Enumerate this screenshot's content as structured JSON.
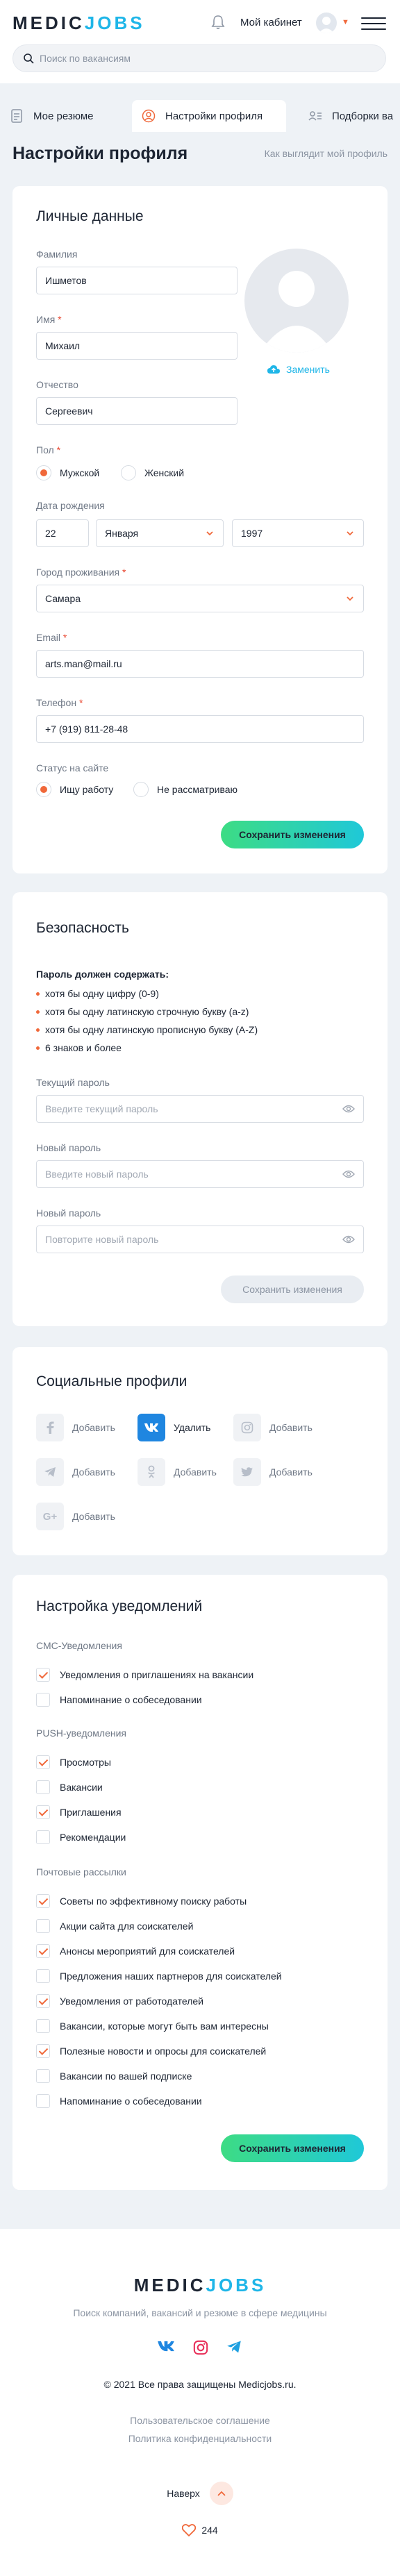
{
  "header": {
    "logo_part1": "MEDIC",
    "logo_part2": "JOBS",
    "cabinet_label": "Мой кабинет",
    "search_placeholder": "Поиск по вакансиям"
  },
  "tabs": [
    {
      "label": "Мое резюме"
    },
    {
      "label": "Настройки профиля"
    },
    {
      "label": "Подборки ва"
    }
  ],
  "page": {
    "title": "Настройки профиля",
    "view_link": "Как выглядит мой профиль"
  },
  "personal": {
    "heading": "Личные данные",
    "lastname_label": "Фамилия",
    "lastname_value": "Ишметов",
    "firstname_label": "Имя",
    "firstname_value": "Михаил",
    "middlename_label": "Отчество",
    "middlename_value": "Сергеевич",
    "replace_photo": "Заменить",
    "gender_label": "Пол",
    "gender_male": "Мужской",
    "gender_female": "Женский",
    "birth_label": "Дата рождения",
    "birth_day": "22",
    "birth_month": "Января",
    "birth_year": "1997",
    "city_label": "Город проживания",
    "city_value": "Самара",
    "email_label": "Email",
    "email_value": "arts.man@mail.ru",
    "phone_label": "Телефон",
    "phone_value": "+7 (919) 811-28-48",
    "status_label": "Статус на сайте",
    "status_looking": "Ищу работу",
    "status_not": "Не рассматриваю",
    "save": "Сохранить изменения",
    "required_mark": "*"
  },
  "security": {
    "heading": "Безопасность",
    "rules_title": "Пароль должен содержать:",
    "rules": [
      "хотя бы одну цифру (0-9)",
      "хотя бы одну латинскую строчную букву (a-z)",
      "хотя бы одну латинскую прописную букву (A-Z)",
      "6 знаков и более"
    ],
    "current_label": "Текущий пароль",
    "current_placeholder": "Введите текущий пароль",
    "new_label": "Новый пароль",
    "new_placeholder": "Введите новый пароль",
    "repeat_label": "Новый пароль",
    "repeat_placeholder": "Повторите новый пароль",
    "save": "Сохранить изменения"
  },
  "social": {
    "heading": "Социальные профили",
    "items": [
      {
        "icon": "facebook-icon",
        "action": "Добавить"
      },
      {
        "icon": "vk-icon",
        "action": "Удалить"
      },
      {
        "icon": "instagram-icon",
        "action": "Добавить"
      },
      {
        "icon": "telegram-icon",
        "action": "Добавить"
      },
      {
        "icon": "odnoklassniki-icon",
        "action": "Добавить"
      },
      {
        "icon": "twitter-icon",
        "action": "Добавить"
      },
      {
        "icon": "google-plus-icon",
        "action": "Добавить"
      }
    ]
  },
  "notifications": {
    "heading": "Настройка уведомлений",
    "sms_title": "СМС-Уведомления",
    "sms": [
      {
        "label": "Уведомления о приглашениях на вакансии",
        "checked": true
      },
      {
        "label": "Напоминание о собеседовании",
        "checked": false
      }
    ],
    "push_title": "PUSH-уведомления",
    "push": [
      {
        "label": "Просмотры",
        "checked": true
      },
      {
        "label": "Вакансии",
        "checked": false
      },
      {
        "label": "Приглашения",
        "checked": true
      },
      {
        "label": "Рекомендации",
        "checked": false
      }
    ],
    "mail_title": "Почтовые рассылки",
    "mail": [
      {
        "label": "Советы по эффективному поиску работы",
        "checked": true
      },
      {
        "label": "Акции сайта для соискателей",
        "checked": false
      },
      {
        "label": "Анонсы мероприятий для соискателей",
        "checked": true
      },
      {
        "label": "Предложения наших партнеров для соискателей",
        "checked": false
      },
      {
        "label": "Уведомления от работодателей",
        "checked": true
      },
      {
        "label": "Вакансии, которые могут быть вам интересны",
        "checked": false
      },
      {
        "label": "Полезные новости и опросы для соискателей",
        "checked": true
      },
      {
        "label": "Вакансии по вашей подписке",
        "checked": false
      },
      {
        "label": "Напоминание о собеседовании",
        "checked": false
      }
    ],
    "save": "Сохранить изменения"
  },
  "footer": {
    "logo_part1": "MEDIC",
    "logo_part2": "JOBS",
    "tagline": "Поиск компаний, вакансий и резюме в сфере медицины",
    "copyright": "© 2021 Все права защищены Medicjobs.ru.",
    "agreement": "Пользовательское соглашение",
    "privacy": "Политика конфиденциальности",
    "up": "Наверх",
    "likes": "244"
  },
  "colors": {
    "accent_orange": "#f0683a",
    "accent_blue": "#1fb6e8",
    "button_gradient_start": "#3ddc84",
    "button_gradient_end": "#1fc8d8",
    "vk_blue": "#1f86e0"
  }
}
